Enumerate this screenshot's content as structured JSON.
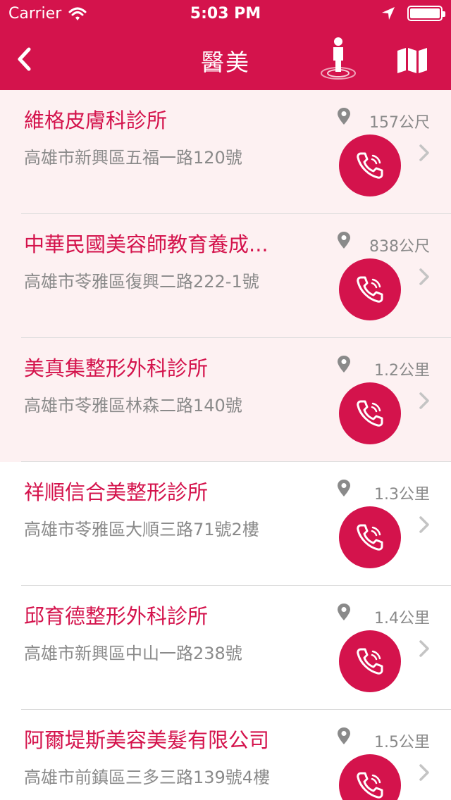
{
  "status_bar": {
    "carrier": "Carrier",
    "time": "5:03 PM"
  },
  "nav": {
    "title": "醫美",
    "back_icon": "chevron-left-icon",
    "person_icon": "person-location-icon",
    "map_icon": "map-icon"
  },
  "colors": {
    "brand": "#d4134c",
    "highlight_bg": "#fdf1f2",
    "secondary_text": "#8a8a8a"
  },
  "clinics": [
    {
      "name": "維格皮膚科診所",
      "address": "高雄市新興區五福一路120號",
      "distance": "157公尺",
      "highlighted": true
    },
    {
      "name": "中華民國美容師教育養成...",
      "address": "高雄市苓雅區復興二路222-1號",
      "distance": "838公尺",
      "highlighted": true
    },
    {
      "name": "美真集整形外科診所",
      "address": "高雄市苓雅區林森二路140號",
      "distance": "1.2公里",
      "highlighted": true
    },
    {
      "name": "祥順信合美整形診所",
      "address": "高雄市苓雅區大順三路71號2樓",
      "distance": "1.3公里",
      "highlighted": false
    },
    {
      "name": "邱育德整形外科診所",
      "address": "高雄市新興區中山一路238號",
      "distance": "1.4公里",
      "highlighted": false
    },
    {
      "name": "阿爾堤斯美容美髮有限公司",
      "address": "高雄市前鎮區三多三路139號4樓",
      "distance": "1.5公里",
      "highlighted": false
    }
  ]
}
